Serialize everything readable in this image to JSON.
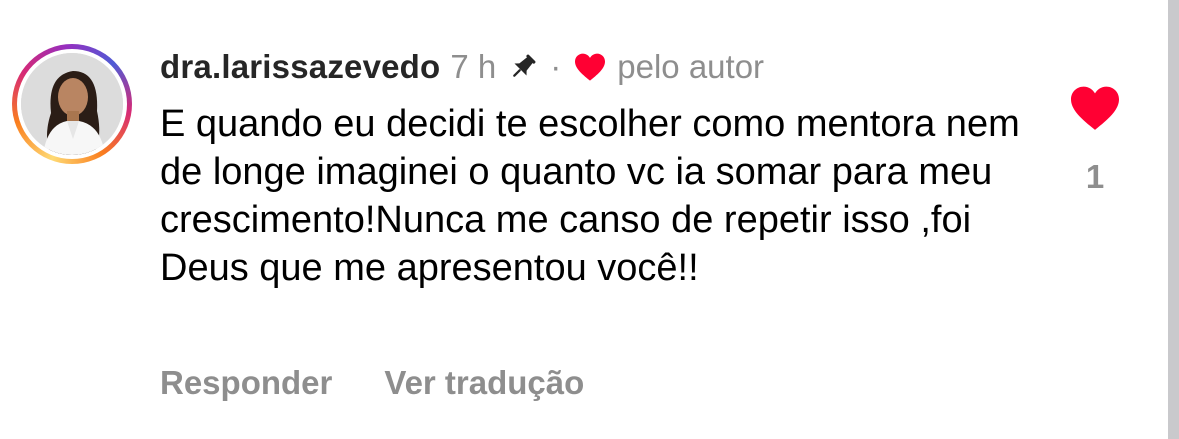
{
  "comment": {
    "username": "dra.larissazevedo",
    "time": "7 h",
    "separator": "·",
    "liked_by_author_label": "pelo autor",
    "text": "E quando eu decidi te escolher como mentora nem de longe imaginei o quanto vc ia somar para meu crescimento!Nunca me canso de repetir isso ,foi Deus que me apresentou você!!",
    "like_count": "1",
    "liked": true
  },
  "actions": {
    "reply_label": "Responder",
    "translate_label": "Ver tradução"
  },
  "icons": {
    "pin": "pin-icon",
    "author_heart": "heart-icon",
    "like": "heart-filled-icon"
  },
  "colors": {
    "heart": "#ff0033",
    "muted_text": "#8e8e8e",
    "username": "#262626",
    "body_text": "#000000",
    "scrollbar": "#c9c9cc"
  }
}
